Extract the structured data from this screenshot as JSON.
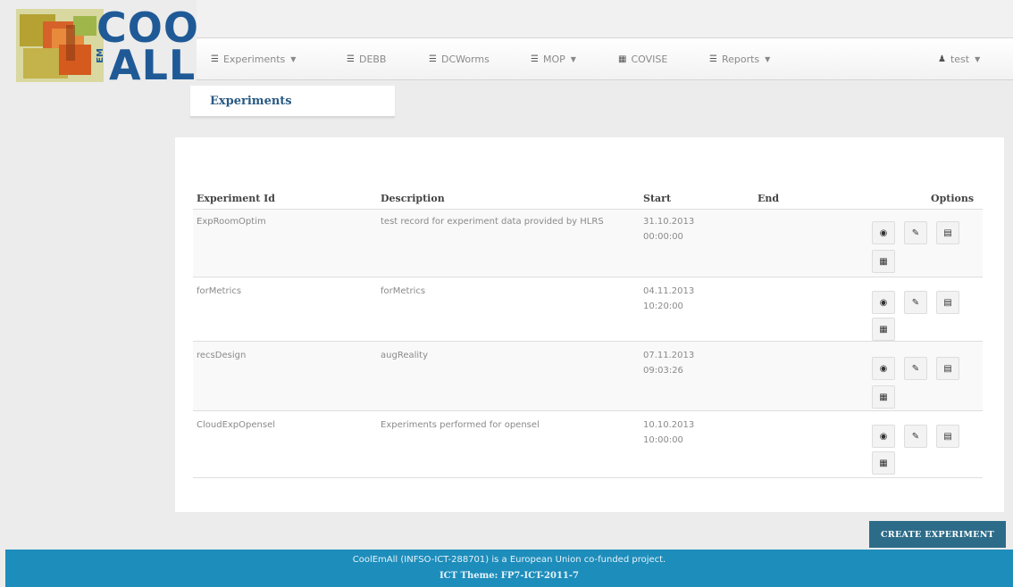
{
  "brand": {
    "line1": "COOL",
    "line2": "ALL",
    "em": "EM"
  },
  "nav": {
    "items": [
      {
        "icon": "list-icon",
        "label": "Experiments",
        "caret": true
      },
      {
        "icon": "list-icon",
        "label": "DEBB",
        "caret": false
      },
      {
        "icon": "list-icon",
        "label": "DCWorms",
        "caret": false
      },
      {
        "icon": "list-icon",
        "label": "MOP",
        "caret": true
      },
      {
        "icon": "list-icon",
        "label": "COVISE",
        "caret": false
      },
      {
        "icon": "list-icon",
        "label": "Reports",
        "caret": true
      }
    ],
    "user": "test"
  },
  "breadcrumb": "Experiments",
  "table": {
    "headers": [
      "Experiment Id",
      "Description",
      "Start",
      "End",
      "Options"
    ],
    "rows": [
      {
        "id": "ExpRoomOptim",
        "desc": "test record for experiment data provided by HLRS",
        "start_date": "31.10.2013",
        "start_time": "00:00:00",
        "end": ""
      },
      {
        "id": "forMetrics",
        "desc": "forMetrics",
        "start_date": "04.11.2013",
        "start_time": "10:20:00",
        "end": ""
      },
      {
        "id": "recsDesign",
        "desc": "augReality",
        "start_date": "07.11.2013",
        "start_time": "09:03:26",
        "end": ""
      },
      {
        "id": "CloudExpOpensel",
        "desc": "Experiments performed for opensel",
        "start_date": "10.10.2013",
        "start_time": "10:00:00",
        "end": ""
      }
    ]
  },
  "create_button": "CREATE EXPERIMENT",
  "footer": {
    "line1": "CoolEmAll (INFSO-ICT-288701) is a European Union co-funded project.",
    "line2": "ICT Theme: FP7-ICT-2011-7"
  },
  "colors": {
    "accent": "#1d8dbb",
    "button": "#2d6c89",
    "brand": "#1f5a97"
  }
}
